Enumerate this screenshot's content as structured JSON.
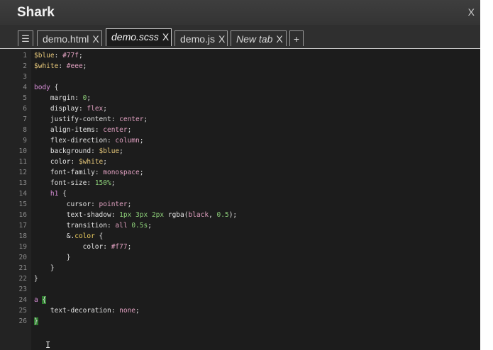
{
  "app": {
    "title": "Shark",
    "close_label": "X"
  },
  "tabs": {
    "menu_label": "☰",
    "add_label": "+",
    "items": [
      {
        "label": "demo.html",
        "close": "X",
        "active": false
      },
      {
        "label": "demo.scss",
        "close": "X",
        "active": true
      },
      {
        "label": "demo.js",
        "close": "X",
        "active": false
      },
      {
        "label": "New tab",
        "close": "X",
        "active": false
      }
    ]
  },
  "editor": {
    "lines": [
      {
        "n": "1",
        "t": "$blue: #77f;"
      },
      {
        "n": "2",
        "t": "$white: #eee;"
      },
      {
        "n": "3",
        "t": ""
      },
      {
        "n": "4",
        "t": "body {"
      },
      {
        "n": "5",
        "t": "    margin: 0;"
      },
      {
        "n": "6",
        "t": "    display: flex;"
      },
      {
        "n": "7",
        "t": "    justify-content: center;"
      },
      {
        "n": "8",
        "t": "    align-items: center;"
      },
      {
        "n": "9",
        "t": "    flex-direction: column;"
      },
      {
        "n": "10",
        "t": "    background: $blue;"
      },
      {
        "n": "11",
        "t": "    color: $white;"
      },
      {
        "n": "12",
        "t": "    font-family: monospace;"
      },
      {
        "n": "13",
        "t": "    font-size: 150%;"
      },
      {
        "n": "14",
        "t": "    h1 {"
      },
      {
        "n": "15",
        "t": "        cursor: pointer;"
      },
      {
        "n": "16",
        "t": "        text-shadow: 1px 3px 2px rgba(black, 0.5);"
      },
      {
        "n": "17",
        "t": "        transition: all 0.5s;"
      },
      {
        "n": "18",
        "t": "        &.color {"
      },
      {
        "n": "19",
        "t": "            color: #f77;"
      },
      {
        "n": "20",
        "t": "        }"
      },
      {
        "n": "21",
        "t": "    }"
      },
      {
        "n": "22",
        "t": "}"
      },
      {
        "n": "23",
        "t": ""
      },
      {
        "n": "24",
        "t": "a {"
      },
      {
        "n": "25",
        "t": "    text-decoration: none;"
      },
      {
        "n": "26",
        "t": "}"
      }
    ]
  },
  "colors": {
    "background": "#1c1c1c",
    "titlebar": "#383838",
    "variable": "#e8c97a",
    "value": "#e0a0c0",
    "number": "#8ed17a",
    "selector": "#d88fd8",
    "bracket_match": "#2f7d2f"
  }
}
